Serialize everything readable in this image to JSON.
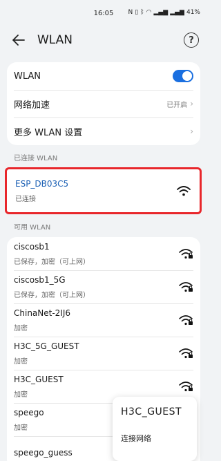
{
  "status_bar": {
    "time": "16:05",
    "battery": "41%"
  },
  "header": {
    "title": "WLAN"
  },
  "settings": {
    "wlan_label": "WLAN",
    "network_boost_label": "网络加速",
    "network_boost_value": "已开启",
    "more_settings_label": "更多 WLAN 设置"
  },
  "connected_section": {
    "header": "已连接 WLAN",
    "network": {
      "name": "ESP_DB03C5",
      "status": "已连接"
    }
  },
  "available_section": {
    "header": "可用 WLAN",
    "networks": [
      {
        "name": "ciscosb1",
        "status": "已保存，加密（可上网）",
        "icon": "wifi-secured-icon"
      },
      {
        "name": "ciscosb1_5G",
        "status": "已保存，加密（可上网）",
        "icon": "wifi-secured-icon"
      },
      {
        "name": "ChinaNet-2IJ6",
        "status": "加密",
        "icon": "wifi-secured-icon"
      },
      {
        "name": "H3C_5G_GUEST",
        "status": "加密",
        "icon": "wifi-secured-icon"
      },
      {
        "name": "H3C_GUEST",
        "status": "加密",
        "icon": "wifi-secured-icon"
      },
      {
        "name": "speego",
        "status": "加密",
        "icon": "wifi-secured-icon"
      },
      {
        "name": "speego_guess",
        "status": "",
        "icon": "wifi-secured-icon"
      }
    ]
  },
  "popup": {
    "title": "H3C_GUEST",
    "action": "连接网络"
  },
  "colors": {
    "accent": "#1a6fe0",
    "highlight_border": "#e8262b",
    "connected_text": "#1a5fb4"
  }
}
